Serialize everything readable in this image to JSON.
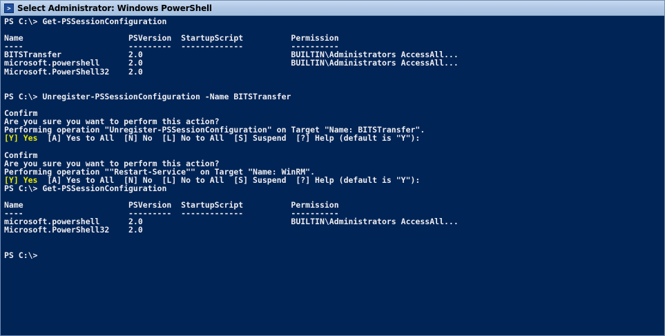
{
  "window": {
    "title": "Select Administrator: Windows PowerShell",
    "icon": "powershell-icon"
  },
  "console": {
    "lines": [
      "PS C:\\> Get-PSSessionConfiguration",
      "",
      "Name                      PSVersion  StartupScript          Permission",
      "----                      ---------  -------------          ----------",
      "BITSTransfer              2.0                               BUILTIN\\Administrators AccessAll...",
      "microsoft.powershell      2.0                               BUILTIN\\Administrators AccessAll...",
      "Microsoft.PowerShell32    2.0",
      "",
      "",
      "PS C:\\> Unregister-PSSessionConfiguration -Name BITSTransfer",
      "",
      "Confirm",
      "Are you sure you want to perform this action?",
      "Performing operation \"Unregister-PSSessionConfiguration\" on Target \"Name: BITSTransfer\".",
      "[Y] Yes  [A] Yes to All  [N] No  [L] No to All  [S] Suspend  [?] Help (default is \"Y\"):",
      "",
      "Confirm",
      "Are you sure you want to perform this action?",
      "Performing operation \"\"Restart-Service\"\" on Target \"Name: WinRM\".",
      "[Y] Yes  [A] Yes to All  [N] No  [L] No to All  [S] Suspend  [?] Help (default is \"Y\"):",
      "PS C:\\> Get-PSSessionConfiguration",
      "",
      "Name                      PSVersion  StartupScript          Permission",
      "----                      ---------  -------------          ----------",
      "microsoft.powershell      2.0                               BUILTIN\\Administrators AccessAll...",
      "Microsoft.PowerShell32    2.0",
      "",
      "",
      "PS C:\\>"
    ],
    "highlight_prefix": "[Y] Yes",
    "colors": {
      "background": "#012456",
      "foreground": "#eeedf0",
      "highlight": "#e8e800"
    }
  }
}
